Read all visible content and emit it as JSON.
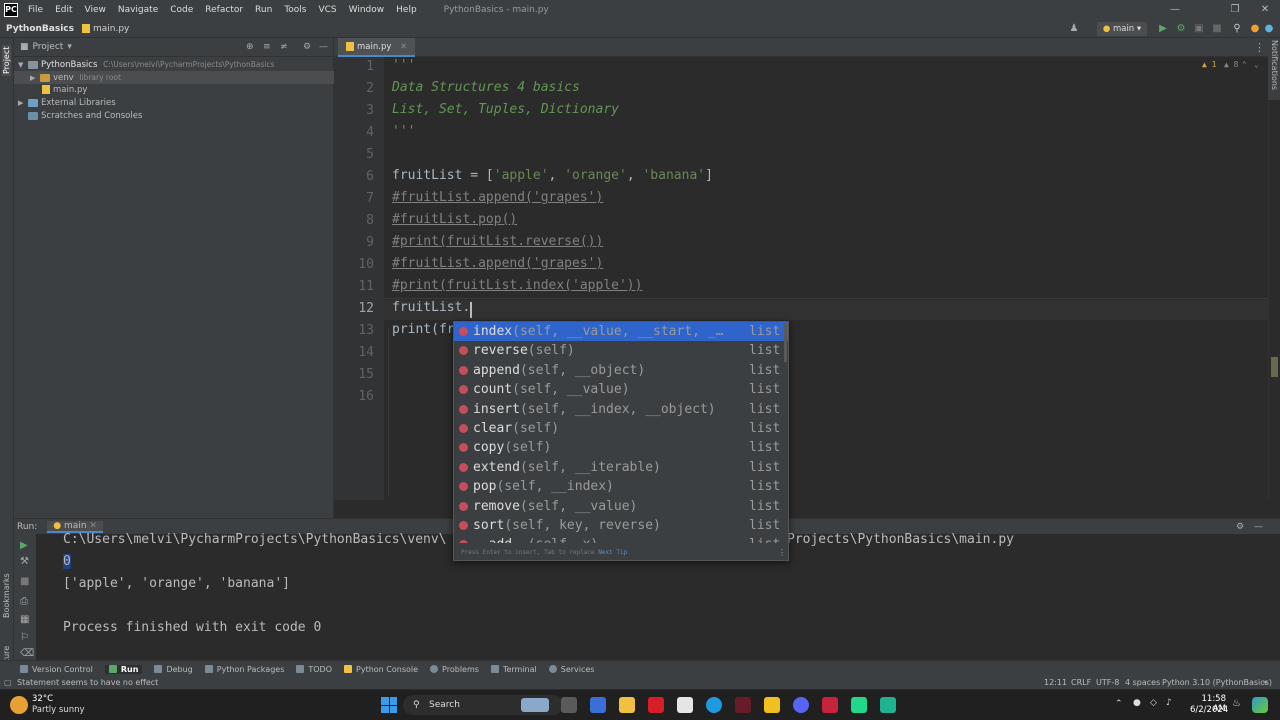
{
  "menubar": {
    "items": [
      "File",
      "Edit",
      "View",
      "Navigate",
      "Code",
      "Refactor",
      "Run",
      "Tools",
      "VCS",
      "Window",
      "Help"
    ],
    "title": "PythonBasics - main.py"
  },
  "navbar": {
    "project": "PythonBasics",
    "file": "main.py",
    "run_config": "main"
  },
  "left_strip": {
    "project": "Project",
    "bookmarks": "Bookmarks",
    "structure": "Structure"
  },
  "right_strip": {
    "notifications": "Notifications"
  },
  "project_panel": {
    "title": "Project",
    "root": "PythonBasics",
    "root_path": "C:\\Users\\melvi\\PycharmProjects\\PythonBasics",
    "venv": "venv",
    "venv_note": "library root",
    "main_file": "main.py",
    "external": "External Libraries",
    "scratches": "Scratches and Consoles"
  },
  "editor": {
    "tab": "main.py",
    "inspection": {
      "warnings": "1",
      "weak": "8"
    },
    "line_numbers": [
      "1",
      "2",
      "3",
      "4",
      "5",
      "6",
      "7",
      "8",
      "9",
      "10",
      "11",
      "12",
      "13",
      "14",
      "15",
      "16"
    ],
    "lines": {
      "l1": "'''",
      "l2": "Data Structures 4 basics",
      "l3": "List, Set, Tuples, Dictionary",
      "l4": "'''",
      "l6a": "fruitList = [",
      "l6b": "'apple'",
      "l6c": ", ",
      "l6d": "'orange'",
      "l6e": ", ",
      "l6f": "'banana'",
      "l6g": "]",
      "l7": "#fruitList.append('grapes')",
      "l8": "#fruitList.pop()",
      "l9": "#print(fruitList.reverse())",
      "l10": "#fruitList.append('grapes')",
      "l11": "#print(fruitList.index('apple'))",
      "l12": "fruitList.",
      "l13": "print(fr"
    }
  },
  "completion": {
    "items": [
      {
        "name": "index",
        "sig": "(self, __value, __start, _…",
        "type": "list"
      },
      {
        "name": "reverse",
        "sig": "(self)",
        "type": "list"
      },
      {
        "name": "append",
        "sig": "(self, __object)",
        "type": "list"
      },
      {
        "name": "count",
        "sig": "(self, __value)",
        "type": "list"
      },
      {
        "name": "insert",
        "sig": "(self, __index, __object)",
        "type": "list"
      },
      {
        "name": "clear",
        "sig": "(self)",
        "type": "list"
      },
      {
        "name": "copy",
        "sig": "(self)",
        "type": "list"
      },
      {
        "name": "extend",
        "sig": "(self, __iterable)",
        "type": "list"
      },
      {
        "name": "pop",
        "sig": "(self, __index)",
        "type": "list"
      },
      {
        "name": "remove",
        "sig": "(self, __value)",
        "type": "list"
      },
      {
        "name": "sort",
        "sig": "(self, key, reverse)",
        "type": "list"
      },
      {
        "name": "__add__",
        "sig": "(self, x)",
        "type": "list"
      }
    ],
    "footer": "Press Enter to insert, Tab to replace",
    "footer_link": "Next Tip"
  },
  "run": {
    "label": "Run:",
    "config": "main",
    "output": {
      "path_left": "C:\\Users\\melvi\\PycharmProjects\\PythonBasics\\venv\\",
      "path_right": "Projects\\PythonBasics\\main.py",
      "line2": "0",
      "line3": "['apple', 'orange', 'banana']",
      "line5": "Process finished with exit code 0"
    }
  },
  "bottom_tools": [
    "Version Control",
    "Run",
    "Debug",
    "Python Packages",
    "TODO",
    "Python Console",
    "Problems",
    "Terminal",
    "Services"
  ],
  "status": {
    "message": "Statement seems to have no effect",
    "position": "12:11",
    "line_sep": "CRLF",
    "encoding": "UTF-8",
    "indent": "4 spaces",
    "interpreter": "Python 3.10 (PythonBasics)"
  },
  "taskbar": {
    "weather_temp": "32°C",
    "weather_desc": "Partly sunny",
    "search": "Search",
    "time": "11:58 AM",
    "date": "6/2/2024"
  }
}
